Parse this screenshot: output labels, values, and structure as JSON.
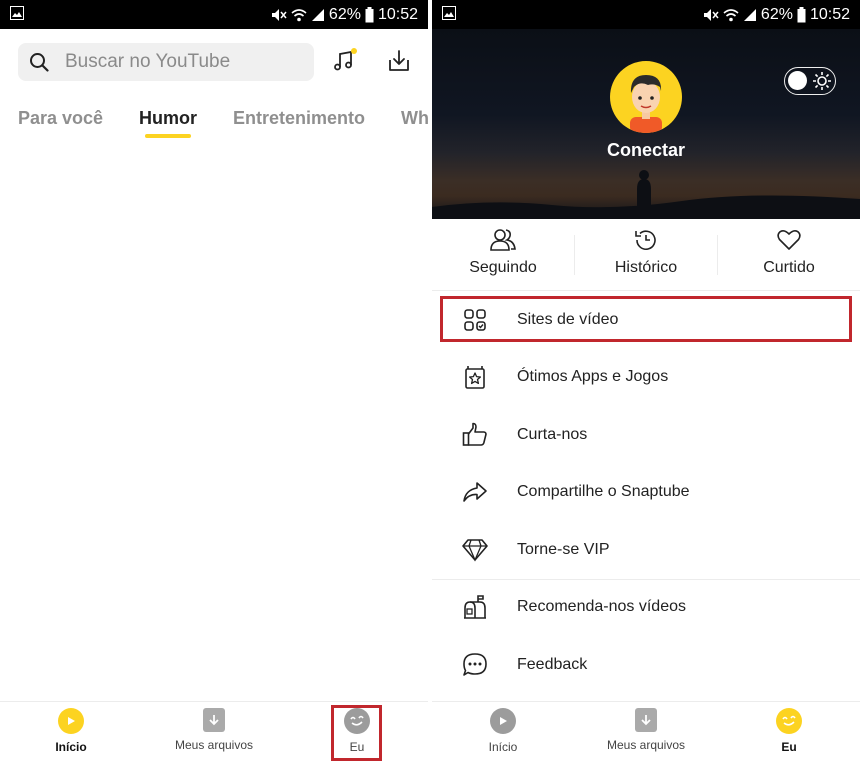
{
  "status_bar": {
    "battery": "62%",
    "time": "10:52"
  },
  "left": {
    "search": {
      "placeholder": "Buscar no YouTube"
    },
    "tabs": [
      {
        "label": "Para você",
        "active": false
      },
      {
        "label": "Humor",
        "active": true
      },
      {
        "label": "Entretenimento",
        "active": false
      },
      {
        "label": "Wh",
        "active": false
      }
    ],
    "bottom_nav": [
      {
        "label": "Início",
        "icon": "play-icon",
        "active": true
      },
      {
        "label": "Meus arquivos",
        "icon": "download-icon",
        "active": false
      },
      {
        "label": "Eu",
        "icon": "smile-icon",
        "active": false,
        "highlighted": true
      }
    ]
  },
  "right": {
    "profile": {
      "connect_label": "Conectar"
    },
    "quick_actions": [
      {
        "label": "Seguindo",
        "icon": "following-icon"
      },
      {
        "label": "Histórico",
        "icon": "history-icon"
      },
      {
        "label": "Curtido",
        "icon": "heart-icon"
      }
    ],
    "menu": [
      {
        "label": "Sites de vídeo",
        "icon": "grid-icon",
        "highlighted": true
      },
      {
        "label": "Ótimos Apps e Jogos",
        "icon": "star-box-icon"
      },
      {
        "label": "Curta-nos",
        "icon": "thumbs-up-icon"
      },
      {
        "label": "Compartilhe o Snaptube",
        "icon": "share-icon"
      },
      {
        "label": "Torne-se VIP",
        "icon": "diamond-icon"
      },
      {
        "label": "Recomenda-nos vídeos",
        "icon": "mailbox-icon"
      },
      {
        "label": "Feedback",
        "icon": "chat-icon"
      }
    ],
    "bottom_nav": [
      {
        "label": "Início",
        "icon": "play-icon",
        "active": false
      },
      {
        "label": "Meus arquivos",
        "icon": "download-icon",
        "active": false
      },
      {
        "label": "Eu",
        "icon": "smile-icon",
        "active": true
      }
    ]
  },
  "colors": {
    "accent": "#fcd321",
    "highlight": "#c1272d",
    "status_bar": "#000000"
  }
}
